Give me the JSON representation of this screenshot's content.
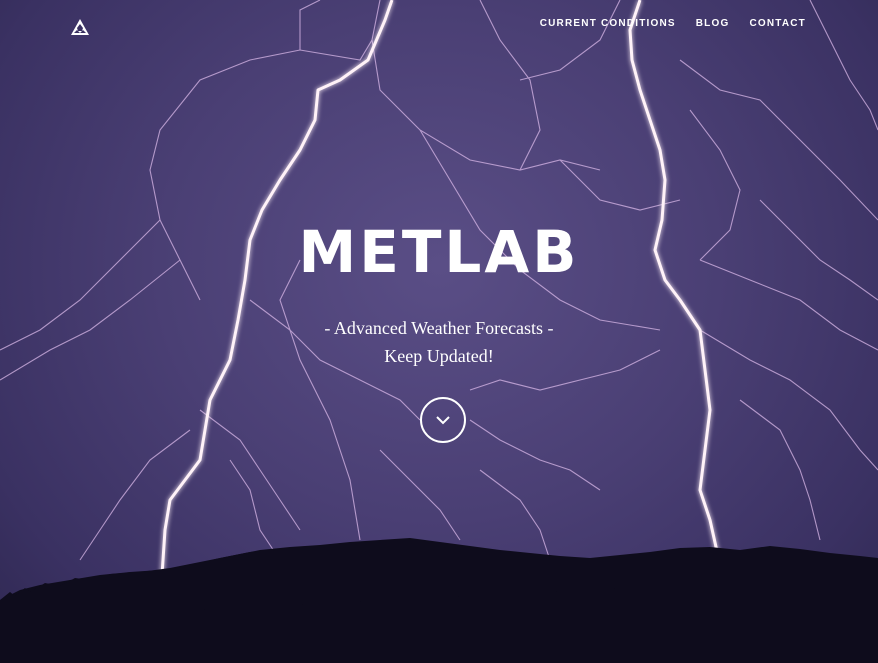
{
  "site": {
    "logo_icon": "mountain-logo-icon"
  },
  "nav": {
    "items": [
      "CURRENT CONDITIONS",
      "BLOG",
      "CONTACT"
    ]
  },
  "hero": {
    "title": "METLAB",
    "tagline_line1": "- Advanced Weather Forecasts -",
    "tagline_line2": "Keep Updated!",
    "scroll_icon": "chevron-down-icon"
  },
  "colors": {
    "sky": "#4a3f74",
    "ridge": "#0e0c1c",
    "lightning": "#fff2f8",
    "text": "#ffffff"
  }
}
